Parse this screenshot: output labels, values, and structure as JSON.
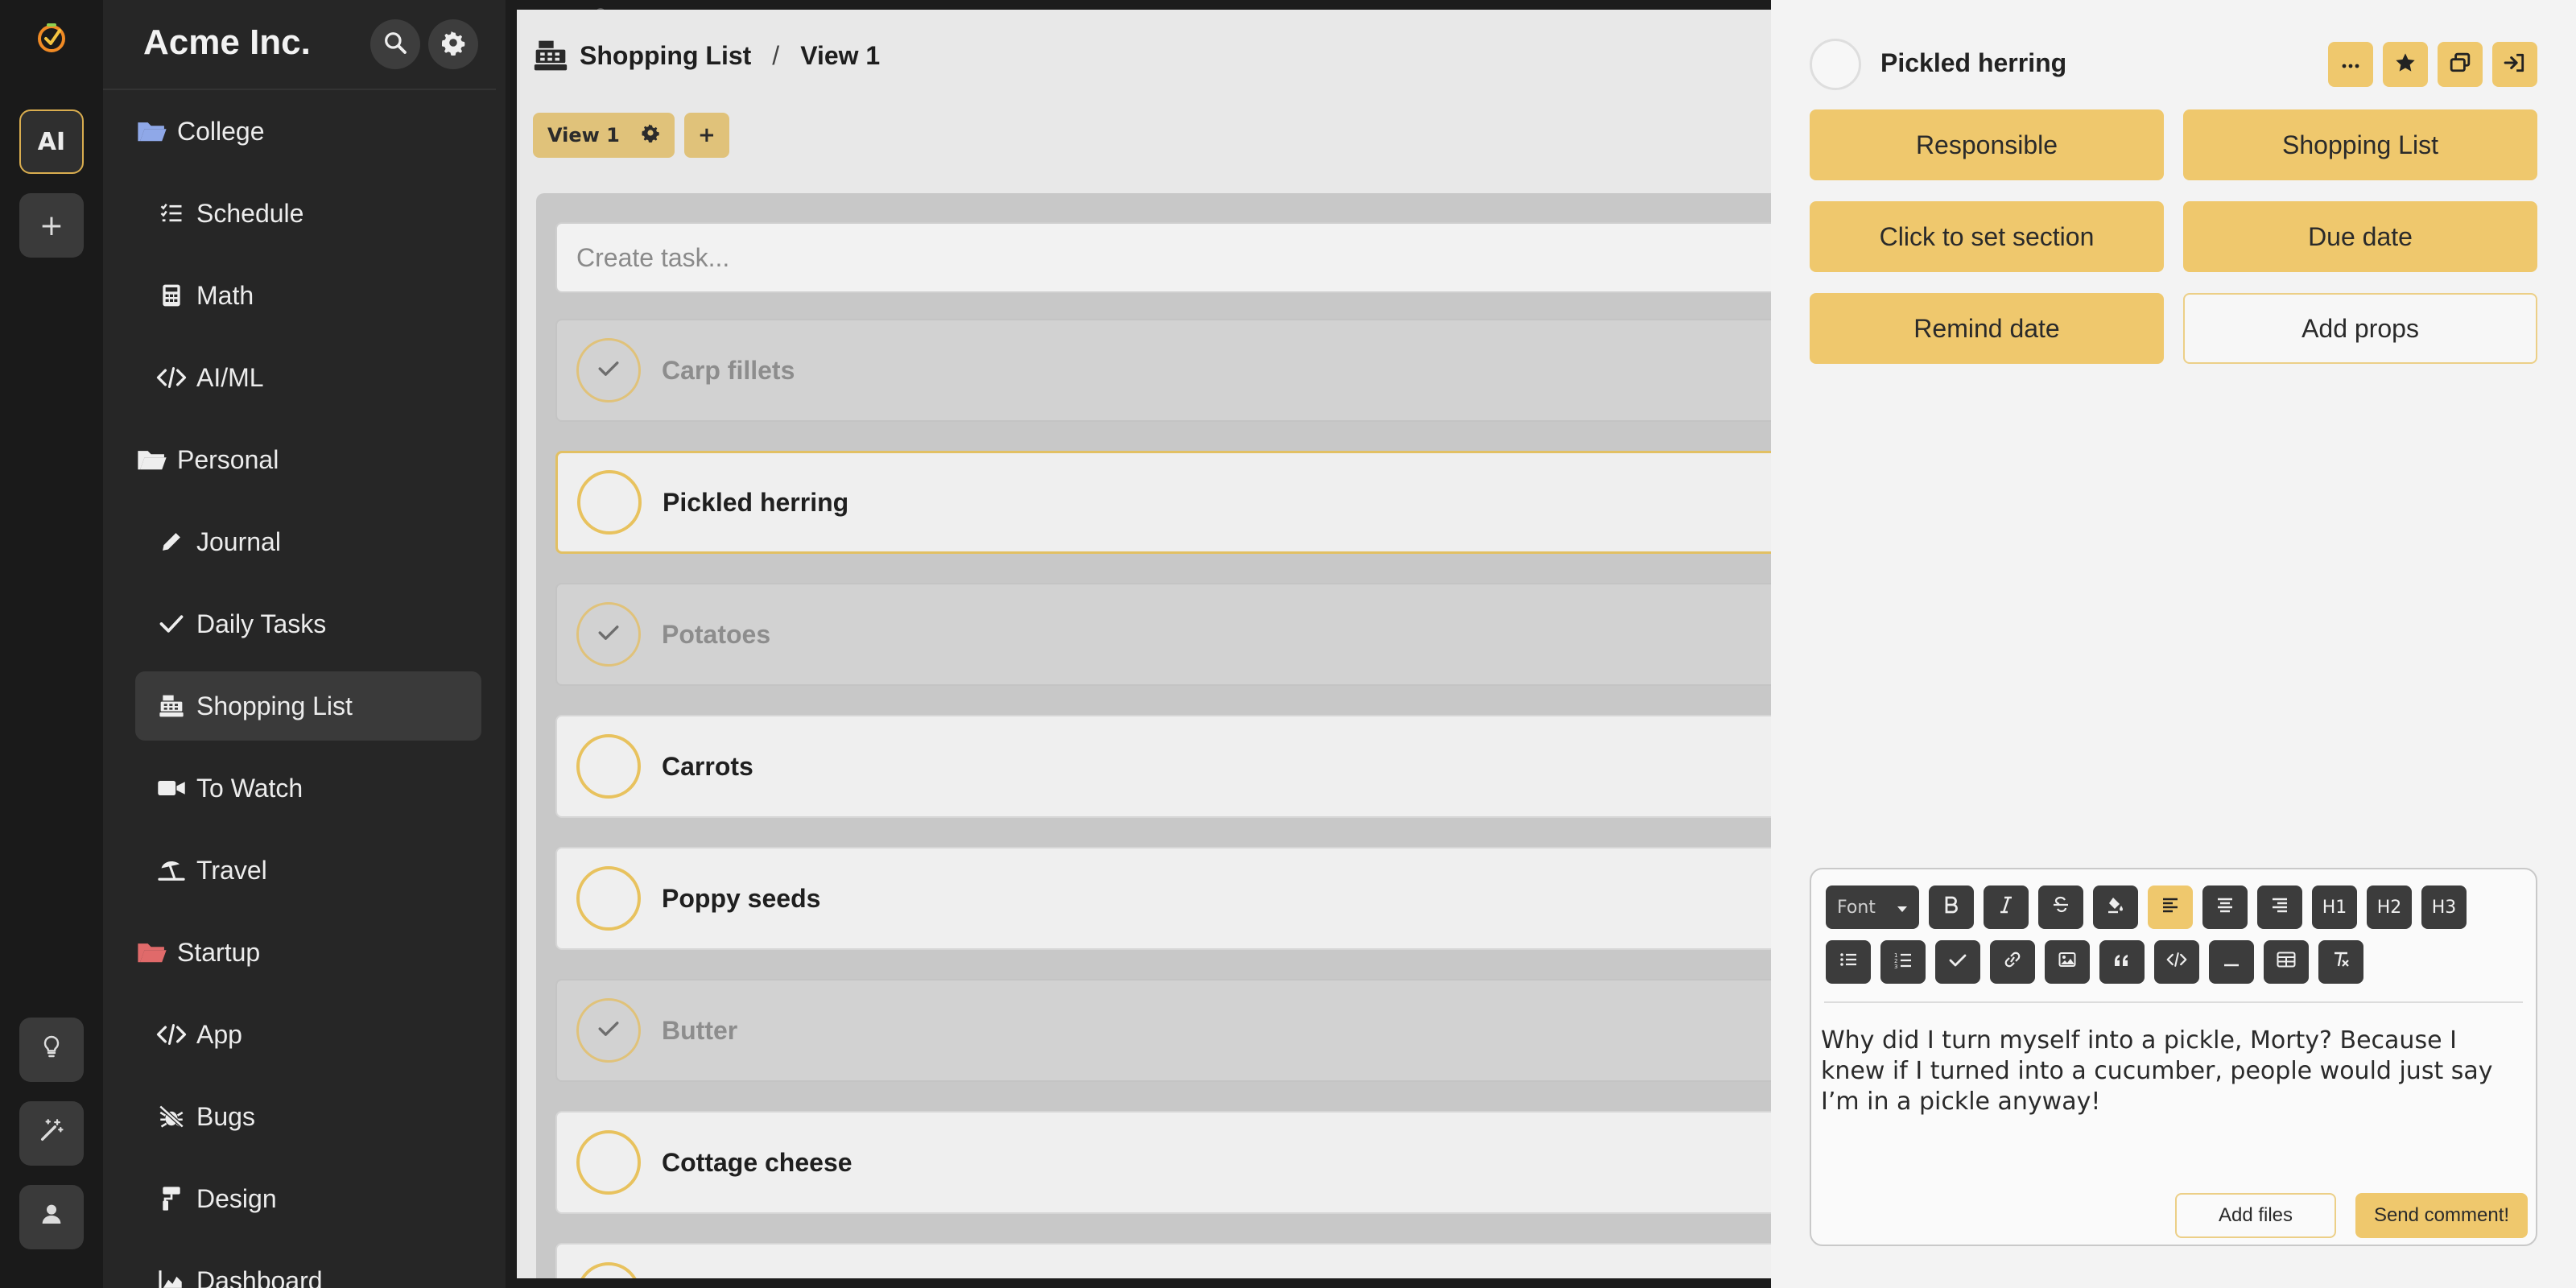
{
  "rail": {
    "ai_label": "AI",
    "add_label": "+",
    "icons": [
      "logo-icon",
      "lightbulb-icon",
      "magic-wand-icon",
      "user-icon"
    ]
  },
  "sidebar": {
    "brand": "Acme Inc.",
    "items": [
      {
        "label": "College",
        "icon": "folder-open-icon",
        "kind": "group",
        "color": "#8fa8e8"
      },
      {
        "label": "Schedule",
        "icon": "list-check-icon",
        "kind": "child"
      },
      {
        "label": "Math",
        "icon": "calculator-icon",
        "kind": "child"
      },
      {
        "label": "AI/ML",
        "icon": "code-icon",
        "kind": "child"
      },
      {
        "label": "Personal",
        "icon": "folder-open-icon",
        "kind": "group",
        "color": "#eeeeee"
      },
      {
        "label": "Journal",
        "icon": "pencil-icon",
        "kind": "child"
      },
      {
        "label": "Daily Tasks",
        "icon": "check-icon",
        "kind": "child"
      },
      {
        "label": "Shopping List",
        "icon": "cash-register-icon",
        "kind": "child",
        "active": true
      },
      {
        "label": "To Watch",
        "icon": "video-icon",
        "kind": "child"
      },
      {
        "label": "Travel",
        "icon": "umbrella-beach-icon",
        "kind": "child"
      },
      {
        "label": "Startup",
        "icon": "folder-open-icon",
        "kind": "group",
        "color": "#e06a6a"
      },
      {
        "label": "App",
        "icon": "code-icon",
        "kind": "child"
      },
      {
        "label": "Bugs",
        "icon": "bug-slash-icon",
        "kind": "child"
      },
      {
        "label": "Design",
        "icon": "paint-roller-icon",
        "kind": "child"
      },
      {
        "label": "Dashboard",
        "icon": "chart-area-icon",
        "kind": "child"
      }
    ]
  },
  "main": {
    "breadcrumb": {
      "project": "Shopping List",
      "separator": "/",
      "view": "View 1"
    },
    "tabs": [
      {
        "label": "View 1"
      }
    ],
    "add_tab_label": "+",
    "create_placeholder": "Create task...",
    "tasks": [
      {
        "name": "Carp fillets",
        "done": true
      },
      {
        "name": "Pickled herring",
        "done": false,
        "selected": true
      },
      {
        "name": "Potatoes",
        "done": true
      },
      {
        "name": "Carrots",
        "done": false
      },
      {
        "name": "Poppy seeds",
        "done": false
      },
      {
        "name": "Butter",
        "done": true
      },
      {
        "name": "Cottage cheese",
        "done": false
      }
    ]
  },
  "panel": {
    "title": "Pickled herring",
    "actions": [
      "more-icon",
      "star-icon",
      "window-restore-icon",
      "sign-in-icon"
    ],
    "buttons": {
      "responsible": "Responsible",
      "project": "Shopping List",
      "section": "Click to set section",
      "due": "Due date",
      "remind": "Remind date",
      "props": "Add props"
    }
  },
  "editor": {
    "font_label": "Font",
    "heading_labels": [
      "H1",
      "H2",
      "H3"
    ],
    "text": "Why did I turn myself into a pickle, Morty? Because I knew if I turned into a cucumber, people would just say I’m in a pickle anyway!",
    "add_files": "Add files",
    "send": "Send comment!"
  },
  "colors": {
    "accent": "#efc86d",
    "rail_bg": "#1a1a1a",
    "sidebar_bg": "#262626",
    "main_bg": "#e8e8e8",
    "panel_bg": "#f3f3f3"
  }
}
